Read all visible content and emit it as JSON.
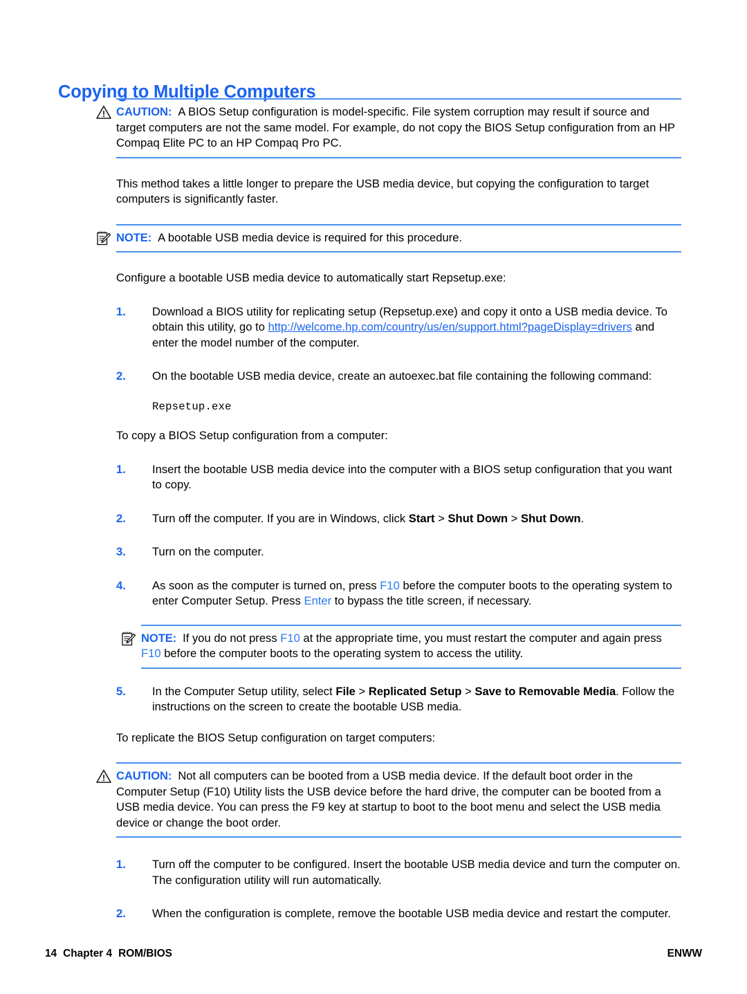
{
  "page": {
    "heading": "Copying to Multiple Computers"
  },
  "caution1": {
    "icon": "warning-triangle-icon",
    "label": "CAUTION:",
    "text": "A BIOS Setup configuration is model-specific. File system corruption may result if source and target computers are not the same model. For example, do not copy the BIOS Setup configuration from an HP Compaq Elite PC to an HP Compaq Pro PC."
  },
  "para1": {
    "text": "This method takes a little longer to prepare the USB media device, but copying the configuration to target computers is significantly faster."
  },
  "note1": {
    "icon": "note-pad-pencil-icon",
    "label": "NOTE:",
    "text": "A bootable USB media device is required for this procedure."
  },
  "para2": {
    "text": "Configure a bootable USB media device to automatically start Repsetup.exe:"
  },
  "list1": {
    "items": [
      {
        "num": "1.",
        "text_before_link": "Download a BIOS utility for replicating setup (Repsetup.exe) and copy it onto a USB media device. To obtain this utility, go to ",
        "link": "http://welcome.hp.com/country/us/en/support.html?pageDisplay=drivers",
        "text_after_link": " and enter the model number of the computer."
      },
      {
        "num": "2.",
        "text": "On the bootable USB media device, create an autoexec.bat file containing the following command:"
      }
    ]
  },
  "code1": {
    "text": "Repsetup.exe"
  },
  "para3": {
    "text": "To copy a BIOS Setup configuration from a computer:"
  },
  "list2": {
    "items": [
      {
        "num": "1.",
        "text": "Insert the bootable USB media device into the computer with a BIOS setup configuration that you want to copy."
      },
      {
        "num": "2.",
        "part1": "Turn off the computer. If you are in Windows, click ",
        "bold1": "Start",
        "sep1": " > ",
        "bold2": "Shut Down",
        "sep2": " > ",
        "bold3": "Shut Down",
        "part2": "."
      },
      {
        "num": "3.",
        "text": "Turn on the computer."
      },
      {
        "num": "4.",
        "part1": "As soon as the computer is turned on, press ",
        "key1": "F10",
        "part2": " before the computer boots to the operating system to enter Computer Setup. Press ",
        "key2": "Enter",
        "part3": " to bypass the title screen, if necessary."
      },
      {
        "num": "5.",
        "part1": "In the Computer Setup utility, select ",
        "bold1": "File",
        "sep1": " > ",
        "bold2": "Replicated Setup",
        "sep2": " > ",
        "bold3": "Save to Removable Media",
        "part2": ". Follow the instructions on the screen to create the bootable USB media."
      }
    ]
  },
  "note2": {
    "icon": "note-pad-pencil-icon",
    "label": "NOTE:",
    "part1": "If you do not press ",
    "key1": "F10",
    "part2": " at the appropriate time, you must restart the computer and again press ",
    "key2": "F10",
    "part3": " before the computer boots to the operating system to access the utility."
  },
  "para4": {
    "text": "To replicate the BIOS Setup configuration on target computers:"
  },
  "caution2": {
    "icon": "warning-triangle-icon",
    "label": "CAUTION:",
    "text": "Not all computers can be booted from a USB media device. If the default boot order in the Computer Setup (F10) Utility lists the USB device before the hard drive, the computer can be booted from a USB media device. You can press the F9 key at startup to boot to the boot menu and select the USB media device or change the boot order."
  },
  "list3": {
    "items": [
      {
        "num": "1.",
        "text": "Turn off the computer to be configured. Insert the bootable USB media device and turn the computer on. The configuration utility will run automatically."
      },
      {
        "num": "2.",
        "text": "When the configuration is complete, remove the bootable USB media device and restart the computer."
      }
    ]
  },
  "footer": {
    "page_number": "14",
    "chapter": "Chapter 4",
    "section": "ROM/BIOS",
    "locale": "ENWW"
  },
  "colors": {
    "heading_blue": "#1a63ef",
    "rule_blue": "#4a90f0",
    "key_blue": "#2a7bf0",
    "link_blue": "#1a63ef",
    "text_black": "#000000"
  }
}
